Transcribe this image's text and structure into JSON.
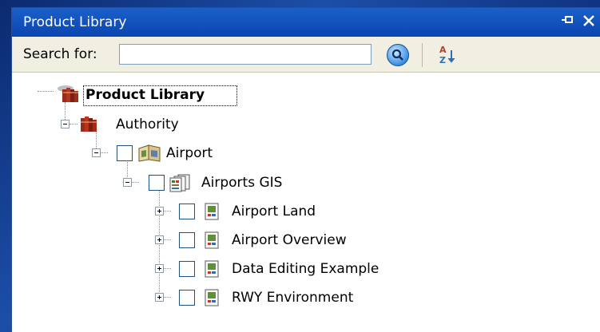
{
  "panel": {
    "title": "Product Library",
    "pin_glyph": "→",
    "close_glyph": "✕"
  },
  "toolbar": {
    "search_label": "Search for:",
    "search_value": "",
    "search_placeholder": "",
    "search_button_icon": "search-icon",
    "sort_button_icon": "sort-az-icon"
  },
  "tree": {
    "root": {
      "label": "Product Library",
      "icon": "library-books-icon"
    },
    "authority": {
      "label": "Authority",
      "icon": "books-icon",
      "expanded": true
    },
    "airport": {
      "label": "Airport",
      "icon": "map-book-icon",
      "expanded": true,
      "checked": false
    },
    "airports_gis": {
      "label": "Airports GIS",
      "icon": "layer-folder-icon",
      "expanded": true,
      "checked": false
    },
    "items": [
      {
        "label": "Airport Land",
        "icon": "map-doc-icon",
        "expanded": false,
        "checked": false
      },
      {
        "label": "Airport Overview",
        "icon": "map-doc-icon",
        "expanded": false,
        "checked": false
      },
      {
        "label": "Data Editing Example",
        "icon": "map-doc-icon",
        "expanded": false,
        "checked": false
      },
      {
        "label": "RWY Environment",
        "icon": "map-doc-icon",
        "expanded": false,
        "checked": false
      }
    ]
  },
  "colors": {
    "titlebar": "#0b45b0",
    "toolbar": "#f1efe2",
    "background": "#1c4ea8"
  }
}
